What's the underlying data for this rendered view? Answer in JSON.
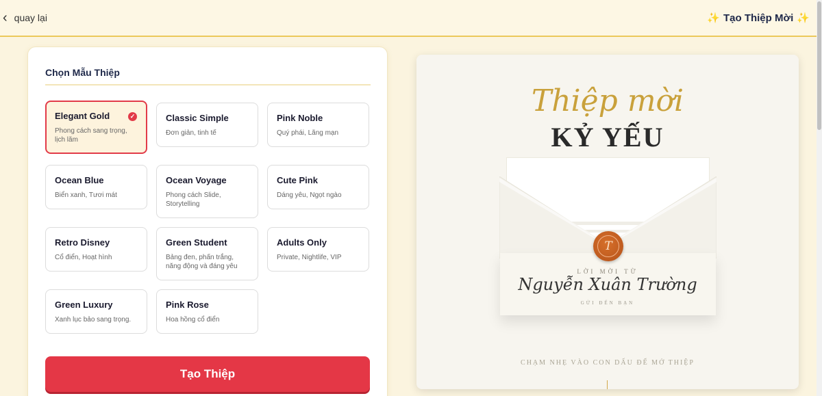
{
  "header": {
    "back_label": "quay lại",
    "brand_title": "Tạo Thiệp Mời",
    "brand_spark": "✨"
  },
  "panel": {
    "title": "Chọn Mẫu Thiệp",
    "templates": [
      {
        "name": "Elegant Gold",
        "desc": "Phong cách sang trọng, lịch lãm",
        "selected": true
      },
      {
        "name": "Classic Simple",
        "desc": "Đơn giản, tinh tế"
      },
      {
        "name": "Pink Noble",
        "desc": "Quý phái, Lãng mạn"
      },
      {
        "name": "Ocean Blue",
        "desc": "Biển xanh, Tươi mát"
      },
      {
        "name": "Ocean Voyage",
        "desc": "Phong cách Slide, Storytelling"
      },
      {
        "name": "Cute Pink",
        "desc": "Dáng yêu, Ngọt ngào"
      },
      {
        "name": "Retro Disney",
        "desc": "Cổ điển, Hoạt hình"
      },
      {
        "name": "Green Student",
        "desc": "Bảng đen, phấn trắng, năng động và đáng yêu"
      },
      {
        "name": "Adults Only",
        "desc": "Private, Nightlife, VIP"
      },
      {
        "name": "Green Luxury",
        "desc": "Xanh lục bảo sang trọng."
      },
      {
        "name": "Pink Rose",
        "desc": "Hoa hồng cổ điển"
      }
    ],
    "check_glyph": "✓",
    "create_button": "Tạo Thiệp"
  },
  "preview": {
    "script_title": "Thiệp mời",
    "big_title": "KỶ YẾU",
    "seal_letter": "T",
    "invite_from": "LỜI MỜI TỪ",
    "invite_name": "Nguyễn Xuân Trường",
    "invite_send": "GỬI ĐẾN BẠN",
    "hint": "CHẠM NHẸ VÀO CON DẤU ĐỂ MỞ THIỆP"
  },
  "colors": {
    "accent_red": "#e43746",
    "gold": "#c9a13b",
    "header_border": "#ecc85a",
    "page_bg": "#fbf4df"
  },
  "icons": {
    "back": "chevron-left-icon",
    "sparkle": "sparkle-icon",
    "check": "check-circle-icon"
  }
}
